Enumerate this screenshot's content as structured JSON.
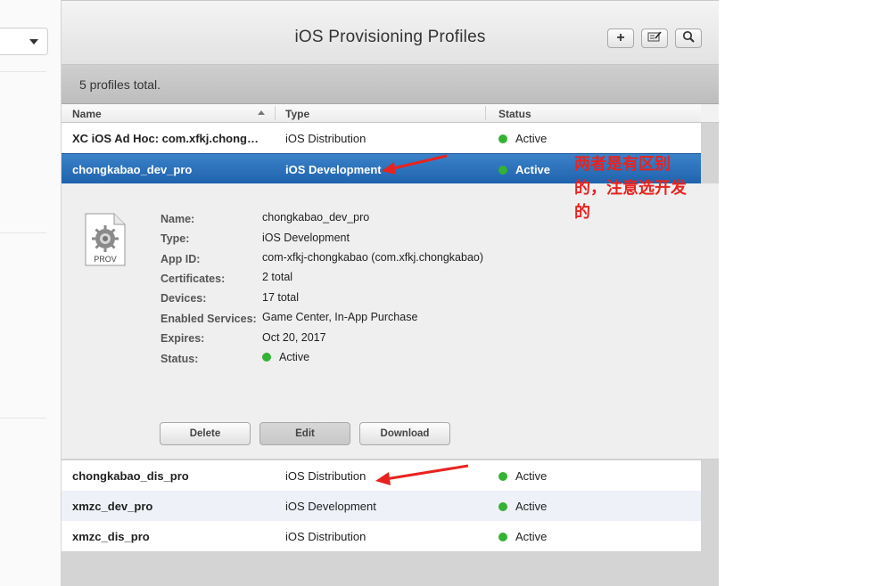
{
  "header": {
    "title": "iOS Provisioning Profiles",
    "buttons": [
      {
        "icon": "plus-icon",
        "glyph": "+"
      },
      {
        "icon": "edit-icon",
        "glyph": "✎"
      },
      {
        "icon": "search-icon",
        "glyph": "⌕"
      }
    ]
  },
  "count_label": "5 profiles total.",
  "columns": {
    "name": "Name",
    "type": "Type",
    "status": "Status"
  },
  "rows": [
    {
      "name": "XC iOS Ad Hoc: com.xfkj.chongkabao",
      "type": "iOS Distribution",
      "status": "Active"
    },
    {
      "name": "chongkabao_dev_pro",
      "type": "iOS Development",
      "status": "Active"
    },
    {
      "name": "chongkabao_dis_pro",
      "type": "iOS Distribution",
      "status": "Active"
    },
    {
      "name": "xmzc_dev_pro",
      "type": "iOS Development",
      "status": "Active"
    },
    {
      "name": "xmzc_dis_pro",
      "type": "iOS Distribution",
      "status": "Active"
    }
  ],
  "detail": {
    "file_icon_label": "PROV",
    "fields": [
      {
        "label": "Name:",
        "value": "chongkabao_dev_pro"
      },
      {
        "label": "Type:",
        "value": "iOS Development"
      },
      {
        "label": "App ID:",
        "value": "com-xfkj-chongkabao (com.xfkj.chongkabao)"
      },
      {
        "label": "Certificates:",
        "value": "2 total"
      },
      {
        "label": "Devices:",
        "value": "17 total"
      },
      {
        "label": "Enabled Services:",
        "value": "Game Center, In-App Purchase"
      },
      {
        "label": "Expires:",
        "value": "Oct 20, 2017"
      },
      {
        "label": "Status:",
        "value": "Active"
      }
    ],
    "buttons": {
      "delete": "Delete",
      "edit": "Edit",
      "download": "Download"
    }
  },
  "annotation": {
    "line1": "两者是有区别",
    "line2": "的，注意选开发",
    "line3": "的"
  },
  "colors": {
    "selected_row": "#1f63ad",
    "status_active": "#34b233",
    "annotation": "#e8231f"
  }
}
